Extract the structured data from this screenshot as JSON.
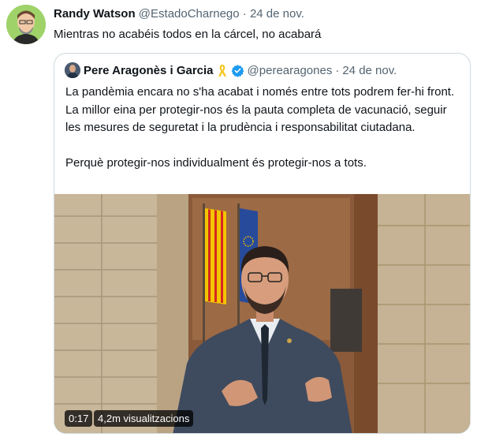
{
  "outer_tweet": {
    "display_name": "Randy Watson",
    "handle": "@EstadoCharnego",
    "separator": "·",
    "date": "24 de nov.",
    "text": "Mientras no acabéis todos en la cárcel, no acabará",
    "avatar_icon": "caricature-avatar-icon"
  },
  "quoted_tweet": {
    "display_name": "Pere Aragonès i Garcia",
    "ribbon_icon": "yellow-ribbon-icon",
    "verified_icon": "verified-badge-icon",
    "handle": "@perearagones",
    "separator": "·",
    "date": "24 de nov.",
    "paragraphs": [
      "La pandèmia encara no s'ha acabat i només entre tots podrem fer-hi front. La millor eina per protegir-nos és la pauta completa de vacunació, seguir les mesures de seguretat i la prudència i responsabilitat ciutadana.",
      "Perquè protegir-nos individualment és protegir-nos a tots."
    ],
    "video": {
      "duration": "0:17",
      "views": "4,2m visualitzacions"
    }
  },
  "colors": {
    "text_primary": "#0f1419",
    "text_secondary": "#536471",
    "border": "#cfd9de",
    "verified_blue": "#1d9bf0",
    "ribbon_yellow": "#f5c518"
  }
}
